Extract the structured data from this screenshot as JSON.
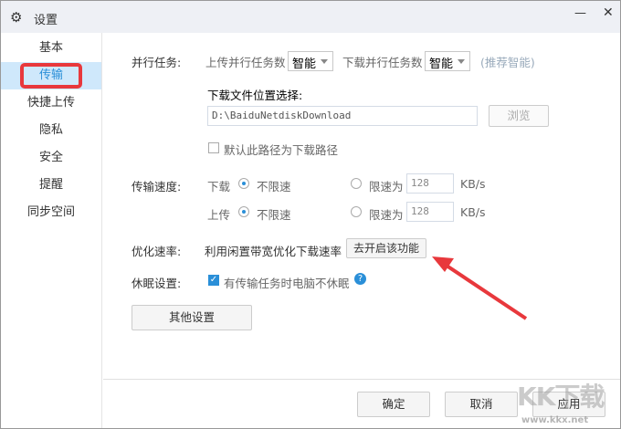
{
  "window": {
    "title": "设置",
    "minimize": "—",
    "close": "✕"
  },
  "sidebar": {
    "items": [
      {
        "label": "基本"
      },
      {
        "label": "传输"
      },
      {
        "label": "快捷上传"
      },
      {
        "label": "隐私"
      },
      {
        "label": "安全"
      },
      {
        "label": "提醒"
      },
      {
        "label": "同步空间"
      }
    ],
    "active": 1
  },
  "parallel": {
    "label": "并行任务:",
    "upload_label": "上传并行任务数",
    "upload_value": "智能",
    "download_label": "下载并行任务数",
    "download_value": "智能",
    "hint": "(推荐智能)"
  },
  "location": {
    "label": "下载文件位置选择:",
    "path": "D:\\BaiduNetdiskDownload",
    "browse": "浏览",
    "default_checkbox": "默认此路径为下载路径",
    "default_checked": false
  },
  "speed": {
    "label": "传输速度:",
    "download": "下载",
    "upload": "上传",
    "unlimited": "不限速",
    "limit": "限速为",
    "download_limit": "128",
    "upload_limit": "128",
    "unit": "KB/s"
  },
  "optimize": {
    "label": "优化速率:",
    "text": "利用闲置带宽优化下载速率",
    "button": "去开启该功能"
  },
  "sleep": {
    "label": "休眠设置:",
    "checkbox": "有传输任务时电脑不休眠",
    "checked": true,
    "help": "?"
  },
  "other_button": "其他设置",
  "footer": {
    "ok": "确定",
    "cancel": "取消",
    "apply": "应用"
  },
  "watermark": {
    "logo": "KK下载",
    "url": "www.kkx.net"
  },
  "colors": {
    "accent": "#2a8fd8",
    "highlight": "#e8383c"
  }
}
